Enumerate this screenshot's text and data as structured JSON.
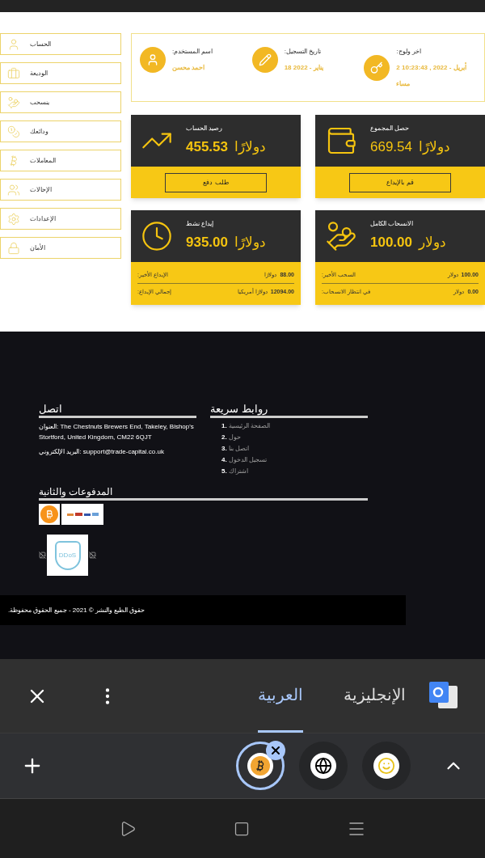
{
  "sidebar": {
    "items": [
      {
        "label": "الحساب"
      },
      {
        "label": "الوديعة"
      },
      {
        "label": "ينسحب"
      },
      {
        "label": "ودائعك"
      },
      {
        "label": "المعاملات"
      },
      {
        "label": "الإحالات"
      },
      {
        "label": "الإعدادات"
      },
      {
        "label": "الأمان"
      }
    ]
  },
  "profile": [
    {
      "label": ":اخر ولوج",
      "lines": [
        "2 10:23:43 , 2022 - أبريل",
        "مساء"
      ]
    },
    {
      "label": ":تاريخ التسجيل",
      "lines": [
        "18 2022 - يناير"
      ]
    },
    {
      "label": ":اسم المستخدم",
      "lines": [
        "احمد محسن"
      ]
    }
  ],
  "cards": [
    {
      "kind": "action",
      "title": "حصل المجموع",
      "amount": "669.54",
      "currency": "دولارًا",
      "amount_bold": false,
      "button": "قم بالإيداع"
    },
    {
      "kind": "action",
      "title": "رصيد الحساب",
      "amount": "455.53",
      "currency": "دولارًا",
      "amount_bold": true,
      "button": "طلب دفع"
    },
    {
      "kind": "summary",
      "title": "الانسحاب الكامل",
      "amount": "100.00",
      "currency": "دولار",
      "amount_bold": true,
      "rows": [
        {
          "label": ":السحب الأخير",
          "value": "100.00",
          "currency": "دولار"
        },
        {
          "label": ":في انتظار الانسحاب",
          "value": "0.00",
          "currency": "دولار"
        }
      ]
    },
    {
      "kind": "summary",
      "title": "إيداع نشط",
      "amount": "935.00",
      "currency": "دولارًا",
      "amount_bold": true,
      "rows": [
        {
          "label": ":الإيداع الأخير",
          "value": "88.00",
          "currency": "دولارًا"
        },
        {
          "label": ":إجمالي الإيداع",
          "value": "12094.00",
          "currency": "دولارًا أمريكيا"
        }
      ]
    }
  ],
  "footer": {
    "contact": {
      "heading": "اتصل",
      "address_label": "العنوان:",
      "address": "The Chestnuts Brewers End, Takeley, Bishop's Stortford, United Kingdom, CM22 6QJT",
      "email_label": "البريد الإلكتروني:",
      "email": "support@trade-capital.co.uk"
    },
    "quick_links": {
      "heading": "روابط سريعة",
      "items": [
        {
          "number": "1.",
          "label": "الصفحة الرئيسية"
        },
        {
          "number": "2.",
          "label": "حول"
        },
        {
          "number": "3.",
          "label": "اتصل بنا"
        },
        {
          "number": "4.",
          "label": "تسجيل الدخول"
        },
        {
          "number": "5.",
          "label": "اشتراك"
        }
      ]
    },
    "payments": {
      "heading": "المدفوعات والثانية",
      "security_badge": "DDoS"
    },
    "copyright": "حقوق الطبع والنشر © 2021 - جميع الحقوق محفوظة."
  },
  "translate_bar": {
    "languages": [
      {
        "label": "الإنجليزية",
        "selected": false
      },
      {
        "label": "العربية",
        "selected": true
      }
    ]
  },
  "tabs": [
    {
      "kind": "bitcoin",
      "selected": true
    },
    {
      "kind": "globe",
      "selected": false
    },
    {
      "kind": "badge",
      "selected": false
    }
  ]
}
